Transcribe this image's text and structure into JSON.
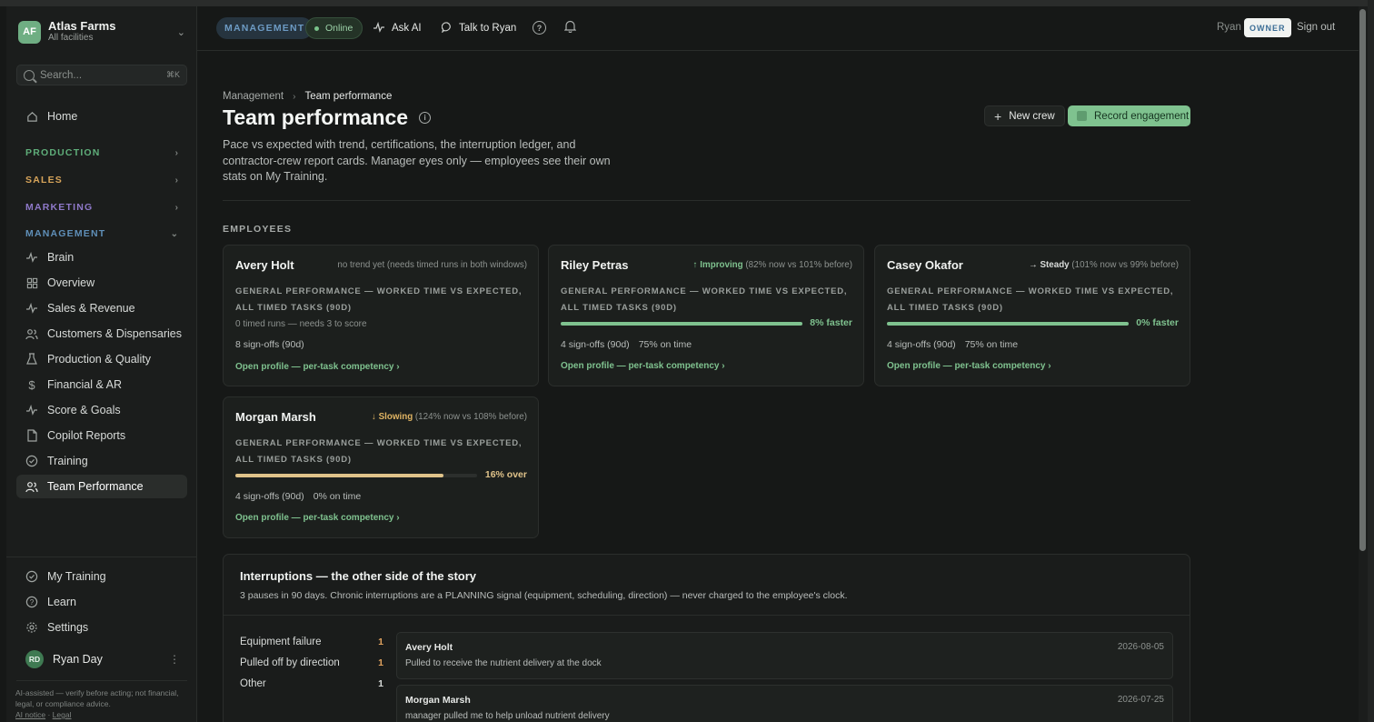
{
  "org": {
    "initials": "AF",
    "name": "Atlas Farms",
    "subtitle": "All facilities"
  },
  "search": {
    "placeholder": "Search...",
    "shortcut": "⌘K"
  },
  "sidebar": {
    "home": "Home",
    "sections": [
      {
        "label": "PRODUCTION",
        "color": "#5fae7a"
      },
      {
        "label": "SALES",
        "color": "#d7a45a"
      },
      {
        "label": "MARKETING",
        "color": "#8f79c9"
      },
      {
        "label": "MANAGEMENT",
        "color": "#5f8fb8"
      }
    ],
    "items": [
      {
        "label": "Brain",
        "icon": "pulse-icon"
      },
      {
        "label": "Overview",
        "icon": "grid-icon"
      },
      {
        "label": "Sales & Revenue",
        "icon": "pulse-icon"
      },
      {
        "label": "Customers & Dispensaries",
        "icon": "users-icon"
      },
      {
        "label": "Production & Quality",
        "icon": "flask-icon"
      },
      {
        "label": "Financial & AR",
        "icon": "dollar-icon"
      },
      {
        "label": "Score & Goals",
        "icon": "pulse-icon"
      },
      {
        "label": "Copilot Reports",
        "icon": "document-icon"
      },
      {
        "label": "Training",
        "icon": "check-circle-icon"
      },
      {
        "label": "Team Performance",
        "icon": "users-icon"
      }
    ],
    "bottom": [
      {
        "label": "My Training",
        "icon": "check-circle-icon"
      },
      {
        "label": "Learn",
        "icon": "help-icon"
      },
      {
        "label": "Settings",
        "icon": "gear-icon"
      }
    ],
    "user": {
      "initials": "RD",
      "name": "Ryan Day"
    },
    "disclaimer": "AI-assisted — verify before acting; not financial, legal, or compliance advice.",
    "ai_notice": "AI notice",
    "link_sep": "·",
    "legal": "Legal"
  },
  "topbar": {
    "mode": "MANAGEMENT",
    "status": "Online",
    "ask_ai": "Ask AI",
    "talk": "Talk to Ryan",
    "user": "Ryan",
    "role": "OWNER",
    "signout": "Sign out"
  },
  "page": {
    "breadcrumb_parent": "Management",
    "breadcrumb_current": "Team performance",
    "title": "Team performance",
    "description": "Pace vs expected with trend, certifications, the interruption ledger, and contractor-crew report cards. Manager eyes only — employees see their own stats on My Training.",
    "new_crew": "New crew",
    "record_engagement": "Record engagement",
    "employees_label": "EMPLOYEES"
  },
  "employees": [
    {
      "name": "Avery Holt",
      "trend_label": "",
      "trend_detail": "no trend yet (needs timed runs in both windows)",
      "trend_color": "#8d928f",
      "perf_label": "GENERAL PERFORMANCE — WORKED TIME VS EXPECTED, ALL TIMED TASKS (90D)",
      "runs_note": "0 timed runs — needs 3 to score",
      "bar_fill": null,
      "bar_label": "",
      "bar_color": "",
      "signoffs": "8 sign-offs (90d)",
      "on_time": "",
      "link": "Open profile — per-task competency ›"
    },
    {
      "name": "Riley Petras",
      "trend_label": "↑ Improving",
      "trend_detail": "(82% now vs 101% before)",
      "trend_color": "#7fc28f",
      "perf_label": "GENERAL PERFORMANCE — WORKED TIME VS EXPECTED, ALL TIMED TASKS (90D)",
      "runs_note": "",
      "bar_fill": 1.0,
      "bar_label": "8% faster",
      "bar_color": "#7fc28f",
      "signoffs": "4 sign-offs (90d)",
      "on_time": "75% on time",
      "link": "Open profile — per-task competency ›"
    },
    {
      "name": "Casey Okafor",
      "trend_label": "→ Steady",
      "trend_detail": "(101% now vs 99% before)",
      "trend_color": "#d9dcda",
      "perf_label": "GENERAL PERFORMANCE — WORKED TIME VS EXPECTED, ALL TIMED TASKS (90D)",
      "runs_note": "",
      "bar_fill": 1.0,
      "bar_label": "0% faster",
      "bar_color": "#7fc28f",
      "signoffs": "4 sign-offs (90d)",
      "on_time": "75% on time",
      "link": "Open profile — per-task competency ›"
    },
    {
      "name": "Morgan Marsh",
      "trend_label": "↓ Slowing",
      "trend_detail": "(124% now vs 108% before)",
      "trend_color": "#e0b463",
      "perf_label": "GENERAL PERFORMANCE — WORKED TIME VS EXPECTED, ALL TIMED TASKS (90D)",
      "runs_note": "",
      "bar_fill": 0.86,
      "bar_label": "16% over",
      "bar_color": "#e0c38a",
      "signoffs": "4 sign-offs (90d)",
      "on_time": "0% on time",
      "link": "Open profile — per-task competency ›"
    }
  ],
  "interruptions": {
    "title": "Interruptions — the other side of the story",
    "subtitle": "3 pauses in 90 days. Chronic interruptions are a PLANNING signal (equipment, scheduling, direction) — never charged to the employee's clock.",
    "categories": [
      {
        "label": "Equipment failure",
        "count": "1",
        "color": "#e0a25e"
      },
      {
        "label": "Pulled off by direction",
        "count": "1",
        "color": "#e0a25e"
      },
      {
        "label": "Other",
        "count": "1",
        "color": "#d9dcda"
      }
    ],
    "entries": [
      {
        "name": "Avery Holt",
        "date": "2026-08-05",
        "text": "Pulled to receive the nutrient delivery at the dock"
      },
      {
        "name": "Morgan Marsh",
        "date": "2026-07-25",
        "text": "manager pulled me to help unload nutrient delivery"
      }
    ]
  }
}
